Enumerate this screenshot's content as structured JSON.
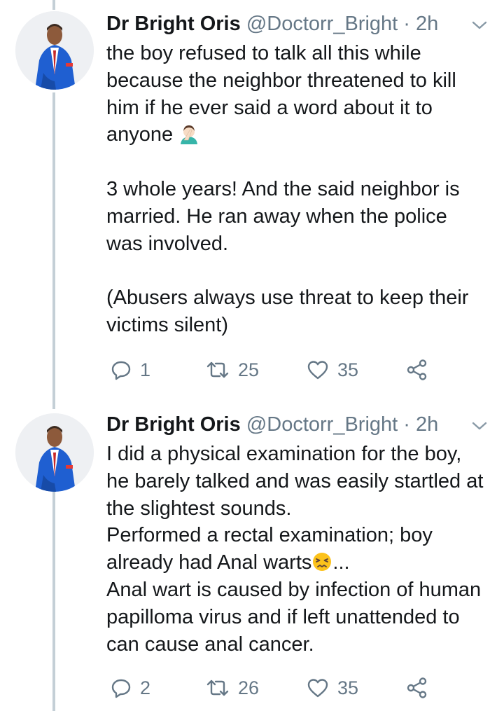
{
  "tweets": [
    {
      "display_name": "Dr Bright Oris",
      "handle": "@Doctorr_Bright",
      "separator": "·",
      "time": "2h",
      "paragraphs": [
        "the boy refused to talk all this while because the neighbor threatened to kill him if he ever said a word about it to anyone",
        "3 whole years! And the said neighbor is married. He ran away when the police was involved.",
        "(Abusers always use threat to keep their victims silent)"
      ],
      "emoji": "facepalm-emoji",
      "replies": "1",
      "retweets": "25",
      "likes": "35"
    },
    {
      "display_name": "Dr Bright Oris",
      "handle": "@Doctorr_Bright",
      "separator": "·",
      "time": "2h",
      "lines": [
        "I did a physical examination for the boy, he barely talked and was easily startled at the slightest sounds.",
        "Performed a rectal examination; boy already had Anal warts",
        "...",
        "Anal wart is caused by infection of human papilloma virus and if left unattended to can cause anal cancer."
      ],
      "emoji": "confounded-face-emoji",
      "replies": "2",
      "retweets": "26",
      "likes": "35"
    }
  ],
  "colors": {
    "text": "#14171a",
    "secondary": "#657786",
    "thread_line": "#c4cfd6",
    "suit": "#1f5fd1"
  },
  "icons": [
    "reply-icon",
    "retweet-icon",
    "like-icon",
    "share-icon",
    "chevron-down-icon"
  ]
}
